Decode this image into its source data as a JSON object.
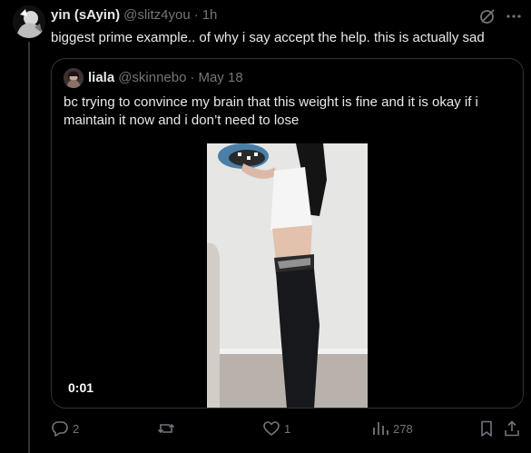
{
  "tweet": {
    "display_name": "yin (sAyin)",
    "handle": "@slitz4you",
    "separator": "·",
    "time": "1h",
    "text": "biggest prime example.. of why i say accept the help. this is actually sad"
  },
  "quote": {
    "display_name": "liala",
    "handle": "@skinnebo",
    "separator": "·",
    "date": "May 18",
    "text": "bc trying to convince my brain that this weight is fine and it is okay if i maintain it now and i don’t need to lose",
    "video_time": "0:01"
  },
  "actions": {
    "replies": "2",
    "reposts": "",
    "likes": "1",
    "views": "278"
  },
  "icons": {
    "grok": "grok-slash-circle-icon",
    "more": "more-dots-icon",
    "reply": "reply-bubble-icon",
    "repost": "repost-arrows-icon",
    "like": "heart-icon",
    "views": "views-bars-icon",
    "bookmark": "bookmark-icon",
    "share": "share-upload-icon"
  },
  "colors": {
    "background": "#000000",
    "text": "#e7e9ea",
    "muted": "#71767b",
    "border": "#2f3336"
  }
}
